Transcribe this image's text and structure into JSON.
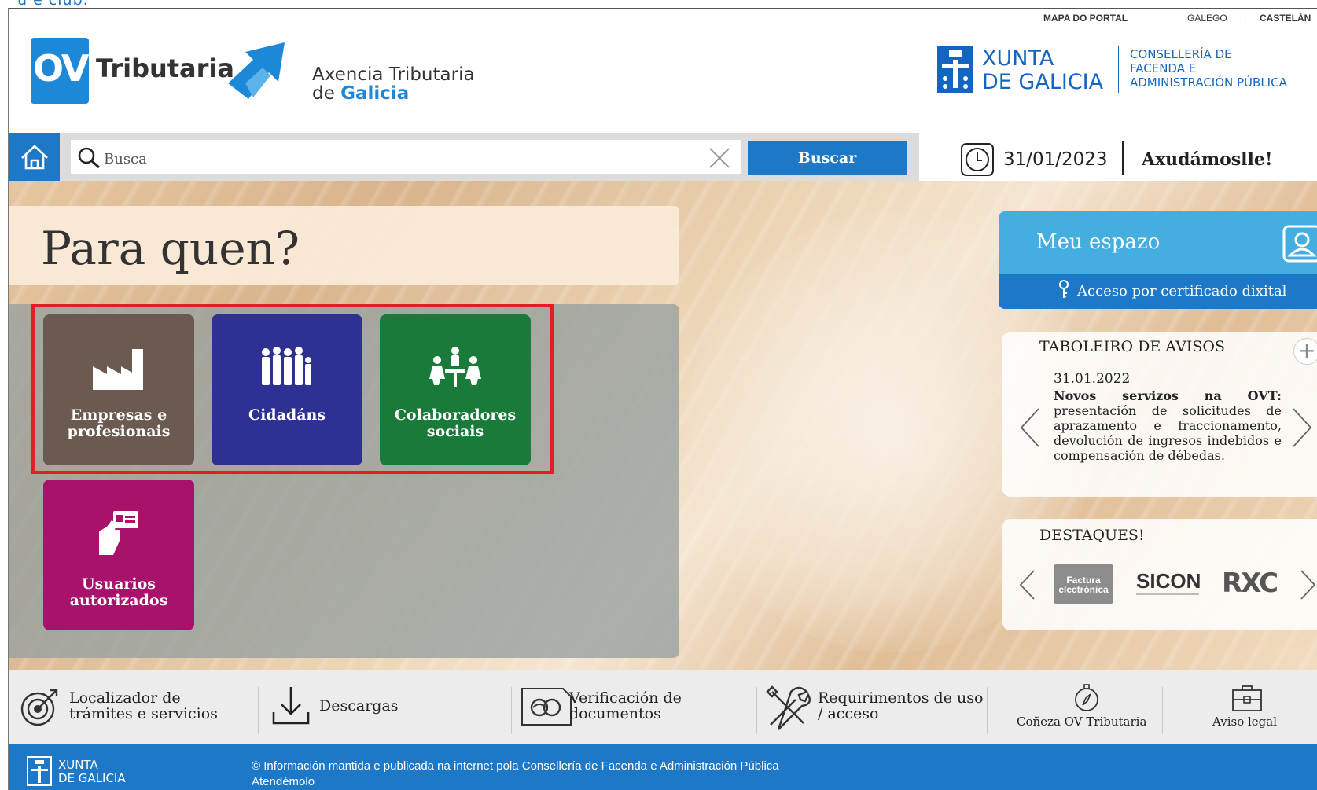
{
  "header": {
    "top_links": {
      "mapa": "MAPA DO PORTAL",
      "galego": "GALEGO",
      "separator": "|",
      "castelan": "CASTELÁN"
    },
    "ov_logo": "OV",
    "ov_logo_word": "Tributaria",
    "agency_line1": "Axencia Tributaria",
    "agency_line2_prefix": "de",
    "agency_line2_bold": "Galicia",
    "xunta_line1": "XUNTA",
    "xunta_line2": "DE GALICIA",
    "consell_line1": "CONSELLERÍA DE",
    "consell_line2": "FACENDA E",
    "consell_line3": "ADMINISTRACIÓN PÚBLICA"
  },
  "search": {
    "placeholder": "Busca",
    "button": "Buscar"
  },
  "status": {
    "date": "31/01/2023",
    "help": "Axudámoslle!"
  },
  "hero": {
    "title": "Para quen?",
    "tiles": [
      {
        "line1": "Empresas e",
        "line2": "profesionais",
        "icon": "factory-icon",
        "color": "#6a5a4f"
      },
      {
        "line1": "Cidadáns",
        "line2": "",
        "icon": "people-icon",
        "color": "#2e3191"
      },
      {
        "line1": "Colaboradores",
        "line2": "sociais",
        "icon": "meeting-icon",
        "color": "#1a7a3a"
      },
      {
        "line1": "Usuarios",
        "line2": "autorizados",
        "icon": "id-card-hand-icon",
        "color": "#a8126a"
      }
    ]
  },
  "meu_espazo": {
    "title": "Meu espazo",
    "access_link": "Acceso por certificado dixital"
  },
  "avisos": {
    "title": "TABOLEIRO DE AVISOS",
    "date": "31.01.2022",
    "bold_lead": "Novos servizos na OVT:",
    "body": "presentación de solicitudes de aprazamento e fraccionamento, devolución de ingresos indebidos e compensación de débedas."
  },
  "destaques": {
    "title": "DESTAQUES!",
    "factura_line1": "Factura",
    "factura_line2": "electrónica",
    "sicon": "SICON",
    "rxc": "RXC"
  },
  "bottom": {
    "localizador_line1": "Localizador de",
    "localizador_line2": "trámites e servicios",
    "descargas": "Descargas",
    "verificacion_line1": "Verificación de",
    "verificacion_line2": "documentos",
    "requirimentos_line1": "Requirimentos de uso",
    "requirimentos_line2": "/ acceso",
    "coneza": "Coñeza OV Tributaria",
    "aviso_legal": "Aviso legal"
  },
  "footer": {
    "xunta_line1": "XUNTA",
    "xunta_line2": "DE GALICIA",
    "info": "© Información mantida e publicada na internet pola Consellería de Facenda e Administración Pública",
    "atendemolo": "Atendémolo"
  },
  "colors": {
    "primary_blue": "#1e78c8",
    "light_blue": "#45aee0",
    "highlight_red": "#e21e25"
  }
}
